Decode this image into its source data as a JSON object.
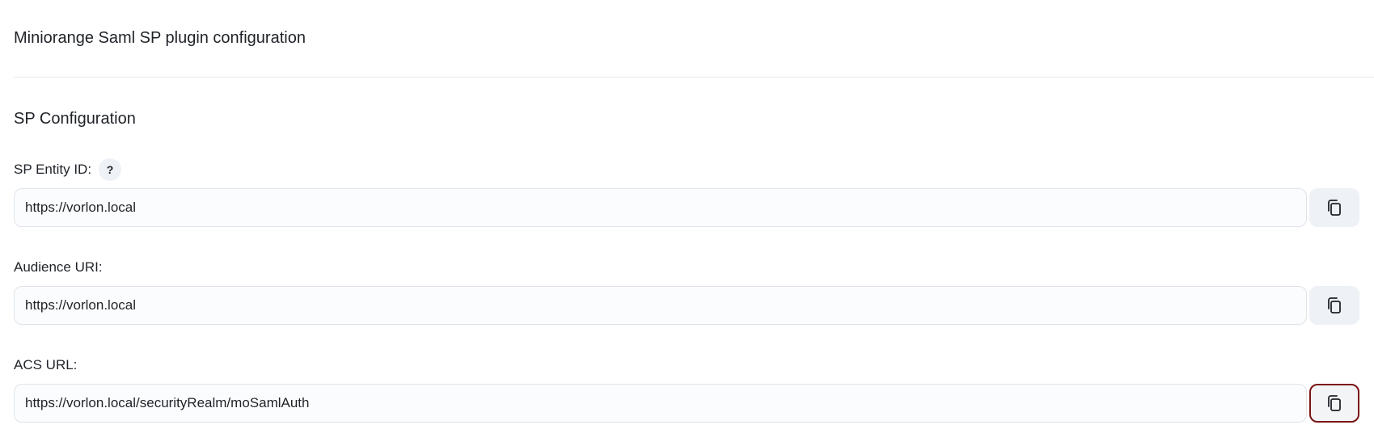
{
  "header": {
    "title": "Miniorange Saml SP plugin configuration"
  },
  "section": {
    "title": "SP Configuration"
  },
  "fields": [
    {
      "label": "SP Entity ID:",
      "value": "https://vorlon.local",
      "help_label": "?"
    },
    {
      "label": "Audience URI:",
      "value": "https://vorlon.local"
    },
    {
      "label": "ACS URL:",
      "value": "https://vorlon.local/securityRealm/moSamlAuth"
    }
  ],
  "icons": {
    "copy": "copy-icon",
    "help": "help-icon"
  },
  "colors": {
    "focus_ring": "#7a1414",
    "input_border": "#dfe3e8",
    "button_bg": "#eef1f5"
  }
}
